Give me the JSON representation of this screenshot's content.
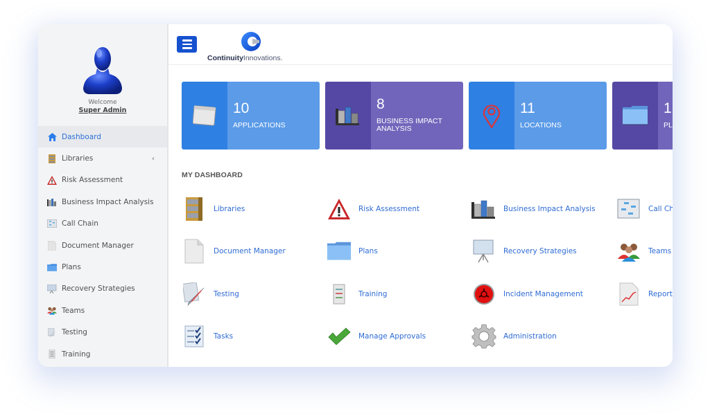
{
  "sidebar": {
    "welcome": "Welcome",
    "username": "Super Admin",
    "items": [
      {
        "label": "Dashboard",
        "icon": "home-icon",
        "active": true
      },
      {
        "label": "Libraries",
        "icon": "bookshelf-icon",
        "caret": "‹"
      },
      {
        "label": "Risk Assessment",
        "icon": "warning-triangle-icon"
      },
      {
        "label": "Business Impact Analysis",
        "icon": "bar-chart-icon"
      },
      {
        "label": "Call Chain",
        "icon": "call-chain-icon"
      },
      {
        "label": "Document Manager",
        "icon": "document-icon"
      },
      {
        "label": "Plans",
        "icon": "folder-icon"
      },
      {
        "label": "Recovery Strategies",
        "icon": "presentation-board-icon"
      },
      {
        "label": "Teams",
        "icon": "team-icon"
      },
      {
        "label": "Testing",
        "icon": "testing-pencil-icon"
      },
      {
        "label": "Training",
        "icon": "training-list-icon"
      }
    ]
  },
  "header": {
    "menu_button": "menu-icon",
    "logo_bold": "Continuity",
    "logo_light": "Innovations."
  },
  "tiles": [
    {
      "count": "10",
      "label": "APPLICATIONS",
      "icon": "application-window-icon",
      "color": "#5b9be8"
    },
    {
      "count": "8",
      "label": "BUSINESS IMPACT ANALYSIS",
      "icon": "bar-chart-icon",
      "color": "#7165bb"
    },
    {
      "count": "11",
      "label": "LOCATIONS",
      "icon": "map-pin-icon",
      "color": "#5b9be8"
    },
    {
      "count": "1",
      "label": "PL",
      "icon": "folder-icon",
      "color": "#7165bb"
    }
  ],
  "dashboard": {
    "title": "MY DASHBOARD",
    "items": [
      {
        "label": "Libraries",
        "icon": "bookshelf-icon"
      },
      {
        "label": "Risk Assessment",
        "icon": "warning-triangle-icon"
      },
      {
        "label": "Business Impact Analysis",
        "icon": "bar-chart-icon"
      },
      {
        "label": "Call Ch",
        "icon": "call-chain-icon"
      },
      {
        "label": "Document Manager",
        "icon": "document-icon"
      },
      {
        "label": "Plans",
        "icon": "folder-icon"
      },
      {
        "label": "Recovery Strategies",
        "icon": "presentation-board-icon"
      },
      {
        "label": "Teams",
        "icon": "team-icon"
      },
      {
        "label": "Testing",
        "icon": "testing-pencil-icon"
      },
      {
        "label": "Training",
        "icon": "training-list-icon"
      },
      {
        "label": "Incident Management",
        "icon": "biohazard-icon"
      },
      {
        "label": "Report",
        "icon": "report-chart-icon"
      },
      {
        "label": "Tasks",
        "icon": "checklist-icon"
      },
      {
        "label": "Manage Approvals",
        "icon": "checkmark-icon"
      },
      {
        "label": "Administration",
        "icon": "gear-icon"
      }
    ]
  },
  "colors": {
    "accent": "#1652cf",
    "link": "#2e6bd4",
    "tile_blue": "#5b9be8",
    "tile_purple": "#7165bb"
  }
}
